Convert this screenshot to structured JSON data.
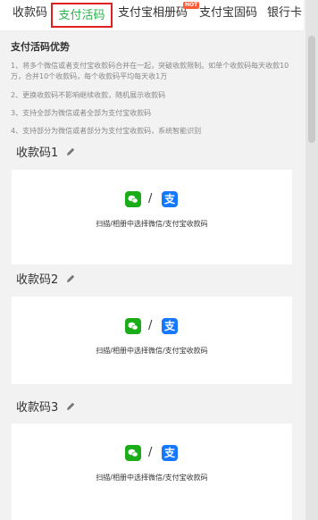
{
  "tabs": [
    {
      "label": "收款码"
    },
    {
      "label": "支付活码"
    },
    {
      "label": "支付宝相册码"
    },
    {
      "label": "支付宝固码"
    },
    {
      "label": "银行卡"
    }
  ],
  "hot_badge": "HOT",
  "advantages": {
    "title": "支付活码优势",
    "items": [
      "1、将多个微信或者支付宝收款码合并在一起，突破收款限制。如单个收款码每天收款10万，合并10个收款码，每个收款码平均每天收1万",
      "2、更换收款码不影响继续收款，随机展示收款码",
      "3、支持全部为微信或者全部为支付宝收款码",
      "4、支持部分为微信或者部分为支付宝收款码，系统智能识别"
    ]
  },
  "codes": [
    {
      "label": "收款码1",
      "caption": "扫描/相册中选择微信/支付宝收款码"
    },
    {
      "label": "收款码2",
      "caption": "扫描/相册中选择微信/支付宝收款码"
    },
    {
      "label": "收款码3",
      "caption": "扫描/相册中选择微信/支付宝收款码"
    }
  ],
  "icons": {
    "wechat": "wechat-icon",
    "alipay": "alipay-icon",
    "alipay_glyph": "支",
    "separator": "/",
    "edit": "pencil-icon"
  },
  "colors": {
    "active_tab_text": "#2ab24b",
    "active_tab_border": "#e02020",
    "wechat": "#1aad19",
    "alipay": "#1677ff"
  }
}
